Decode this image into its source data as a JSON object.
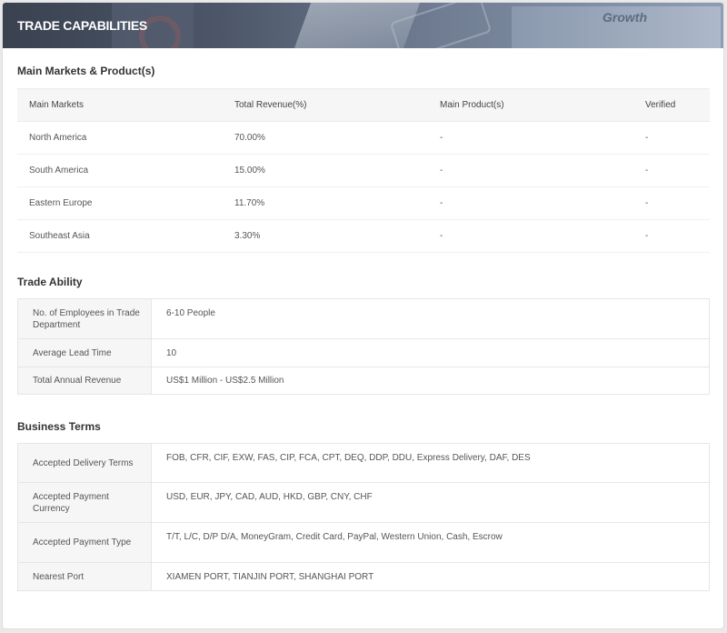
{
  "header": {
    "title": "TRADE CAPABILITIES",
    "banner_text": "Growth"
  },
  "markets": {
    "section_title": "Main Markets & Product(s)",
    "columns": [
      "Main Markets",
      "Total Revenue(%)",
      "Main Product(s)",
      "Verified"
    ],
    "rows": [
      [
        "North America",
        "70.00%",
        "-",
        "-"
      ],
      [
        "South America",
        "15.00%",
        "-",
        "-"
      ],
      [
        "Eastern Europe",
        "11.70%",
        "-",
        "-"
      ],
      [
        "Southeast Asia",
        "3.30%",
        "-",
        "-"
      ]
    ]
  },
  "trade_ability": {
    "section_title": "Trade Ability",
    "rows": [
      {
        "label": "No. of Employees in Trade Department",
        "value": "6-10 People"
      },
      {
        "label": "Average Lead Time",
        "value": "10"
      },
      {
        "label": "Total Annual Revenue",
        "value": "US$1 Million - US$2.5 Million"
      }
    ]
  },
  "business_terms": {
    "section_title": "Business Terms",
    "rows": [
      {
        "label": "Accepted Delivery Terms",
        "value": "FOB, CFR, CIF, EXW, FAS, CIP, FCA, CPT, DEQ, DDP, DDU, Express Delivery, DAF, DES"
      },
      {
        "label": "Accepted Payment Currency",
        "value": "USD, EUR, JPY, CAD, AUD, HKD, GBP, CNY, CHF"
      },
      {
        "label": "Accepted Payment Type",
        "value": "T/T, L/C, D/P D/A, MoneyGram, Credit Card, PayPal, Western Union, Cash, Escrow"
      },
      {
        "label": "Nearest Port",
        "value": "XIAMEN PORT, TIANJIN PORT, SHANGHAI PORT"
      }
    ]
  }
}
